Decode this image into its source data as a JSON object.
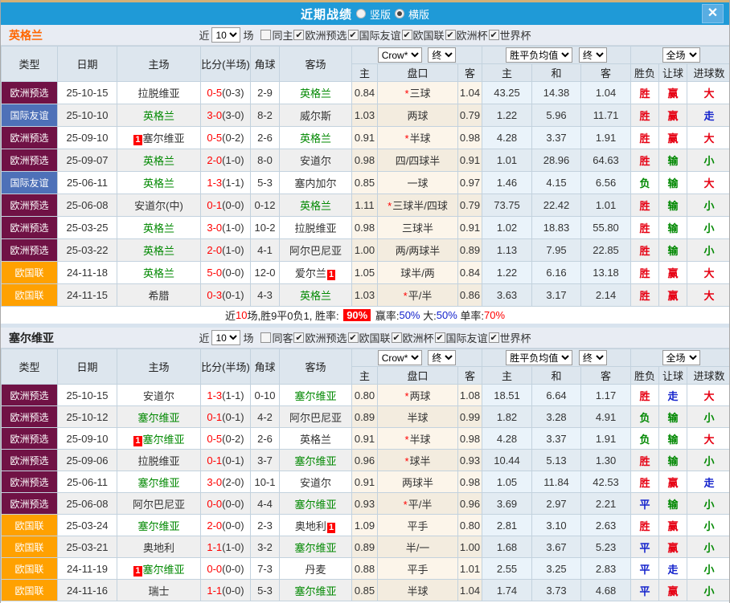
{
  "titlebar": {
    "title": "近期战绩",
    "vertical_label": "竖版",
    "horizontal_label": "横版",
    "selected_layout": "横版",
    "close_label": "✕"
  },
  "table_header": {
    "main": [
      "类型",
      "日期",
      "主场",
      "比分(半场)",
      "角球",
      "客场"
    ],
    "odds_group": {
      "select1": "Crow*",
      "select2": "终",
      "cols": [
        "主",
        "盘口",
        "客"
      ]
    },
    "avg_group": {
      "select1": "胜平负均值",
      "select2": "终",
      "cols": [
        "主",
        "和",
        "客"
      ]
    },
    "result_group": {
      "select": "全场",
      "cols": [
        "胜负",
        "让球",
        "进球数"
      ]
    }
  },
  "type_colors": {
    "欧洲预选": "#701245",
    "国际友谊": "#4e71b8",
    "欧国联": "#ffa101"
  },
  "result_colors": {
    "red": "#e60012",
    "green": "#008800",
    "blue": "#1322cc"
  },
  "score_color": "#ff0000",
  "team_focus_color": "#008800",
  "sections": [
    {
      "team": "英格兰",
      "team_color": "#ff6600",
      "filter": {
        "near": "近",
        "count": "10",
        "games": "场",
        "same": {
          "label": "同主",
          "checked": false
        },
        "leagues": [
          {
            "label": "欧洲预选",
            "checked": true
          },
          {
            "label": "国际友谊",
            "checked": true
          },
          {
            "label": "欧国联",
            "checked": true
          },
          {
            "label": "欧洲杯",
            "checked": true
          },
          {
            "label": "世界杯",
            "checked": true
          }
        ]
      },
      "rows": [
        {
          "type": "欧洲预选",
          "date": "25-10-15",
          "home": {
            "n": "拉脱维亚"
          },
          "score": "0-5",
          "half": "(0-3)",
          "corner": "2-9",
          "away": {
            "n": "英格兰",
            "f": 1
          },
          "o1": "0.84",
          "hc": {
            "s": 1,
            "t": "三球"
          },
          "o2": "1.04",
          "a1": "43.25",
          "a2": "14.38",
          "a3": "1.04",
          "res": {
            "t": "胜",
            "c": "red"
          },
          "hcr": {
            "t": "赢",
            "c": "red"
          },
          "goal": {
            "t": "大",
            "c": "red"
          }
        },
        {
          "type": "国际友谊",
          "date": "25-10-10",
          "home": {
            "n": "英格兰",
            "f": 1
          },
          "score": "3-0",
          "half": "(3-0)",
          "corner": "8-2",
          "away": {
            "n": "威尔斯"
          },
          "o1": "1.03",
          "hc": {
            "t": "两球"
          },
          "o2": "0.79",
          "a1": "1.22",
          "a2": "5.96",
          "a3": "11.71",
          "res": {
            "t": "胜",
            "c": "red"
          },
          "hcr": {
            "t": "赢",
            "c": "red"
          },
          "goal": {
            "t": "走",
            "c": "blue"
          }
        },
        {
          "type": "欧洲预选",
          "date": "25-09-10",
          "home": {
            "n": "塞尔维亚",
            "b": "before"
          },
          "score": "0-5",
          "half": "(0-2)",
          "corner": "2-6",
          "away": {
            "n": "英格兰",
            "f": 1
          },
          "o1": "0.91",
          "hc": {
            "s": 1,
            "t": "半球"
          },
          "o2": "0.98",
          "a1": "4.28",
          "a2": "3.37",
          "a3": "1.91",
          "res": {
            "t": "胜",
            "c": "red"
          },
          "hcr": {
            "t": "赢",
            "c": "red"
          },
          "goal": {
            "t": "大",
            "c": "red"
          }
        },
        {
          "type": "欧洲预选",
          "date": "25-09-07",
          "home": {
            "n": "英格兰",
            "f": 1
          },
          "score": "2-0",
          "half": "(1-0)",
          "corner": "8-0",
          "away": {
            "n": "安道尔"
          },
          "o1": "0.98",
          "hc": {
            "t": "四/四球半"
          },
          "o2": "0.91",
          "a1": "1.01",
          "a2": "28.96",
          "a3": "64.63",
          "res": {
            "t": "胜",
            "c": "red"
          },
          "hcr": {
            "t": "输",
            "c": "green"
          },
          "goal": {
            "t": "小",
            "c": "green"
          }
        },
        {
          "type": "国际友谊",
          "date": "25-06-11",
          "home": {
            "n": "英格兰",
            "f": 1
          },
          "score": "1-3",
          "half": "(1-1)",
          "corner": "5-3",
          "away": {
            "n": "塞内加尔"
          },
          "o1": "0.85",
          "hc": {
            "t": "一球"
          },
          "o2": "0.97",
          "a1": "1.46",
          "a2": "4.15",
          "a3": "6.56",
          "res": {
            "t": "负",
            "c": "green"
          },
          "hcr": {
            "t": "输",
            "c": "green"
          },
          "goal": {
            "t": "大",
            "c": "red"
          }
        },
        {
          "type": "欧洲预选",
          "date": "25-06-08",
          "home": {
            "n": "安道尔(中)"
          },
          "score": "0-1",
          "half": "(0-0)",
          "corner": "0-12",
          "away": {
            "n": "英格兰",
            "f": 1
          },
          "o1": "1.11",
          "hc": {
            "s": 1,
            "t": "三球半/四球"
          },
          "o2": "0.79",
          "a1": "73.75",
          "a2": "22.42",
          "a3": "1.01",
          "res": {
            "t": "胜",
            "c": "red"
          },
          "hcr": {
            "t": "输",
            "c": "green"
          },
          "goal": {
            "t": "小",
            "c": "green"
          }
        },
        {
          "type": "欧洲预选",
          "date": "25-03-25",
          "home": {
            "n": "英格兰",
            "f": 1
          },
          "score": "3-0",
          "half": "(1-0)",
          "corner": "10-2",
          "away": {
            "n": "拉脱维亚"
          },
          "o1": "0.98",
          "hc": {
            "t": "三球半"
          },
          "o2": "0.91",
          "a1": "1.02",
          "a2": "18.83",
          "a3": "55.80",
          "res": {
            "t": "胜",
            "c": "red"
          },
          "hcr": {
            "t": "输",
            "c": "green"
          },
          "goal": {
            "t": "小",
            "c": "green"
          }
        },
        {
          "type": "欧洲预选",
          "date": "25-03-22",
          "home": {
            "n": "英格兰",
            "f": 1
          },
          "score": "2-0",
          "half": "(1-0)",
          "corner": "4-1",
          "away": {
            "n": "阿尔巴尼亚"
          },
          "o1": "1.00",
          "hc": {
            "t": "两/两球半"
          },
          "o2": "0.89",
          "a1": "1.13",
          "a2": "7.95",
          "a3": "22.85",
          "res": {
            "t": "胜",
            "c": "red"
          },
          "hcr": {
            "t": "输",
            "c": "green"
          },
          "goal": {
            "t": "小",
            "c": "green"
          }
        },
        {
          "type": "欧国联",
          "date": "24-11-18",
          "home": {
            "n": "英格兰",
            "f": 1
          },
          "score": "5-0",
          "half": "(0-0)",
          "corner": "12-0",
          "away": {
            "n": "爱尔兰",
            "b": "after"
          },
          "o1": "1.05",
          "hc": {
            "t": "球半/两"
          },
          "o2": "0.84",
          "a1": "1.22",
          "a2": "6.16",
          "a3": "13.18",
          "res": {
            "t": "胜",
            "c": "red"
          },
          "hcr": {
            "t": "赢",
            "c": "red"
          },
          "goal": {
            "t": "大",
            "c": "red"
          }
        },
        {
          "type": "欧国联",
          "date": "24-11-15",
          "home": {
            "n": "希腊"
          },
          "score": "0-3",
          "half": "(0-1)",
          "corner": "4-3",
          "away": {
            "n": "英格兰",
            "f": 1
          },
          "o1": "1.03",
          "hc": {
            "s": 1,
            "t": "平/半"
          },
          "o2": "0.86",
          "a1": "3.63",
          "a2": "3.17",
          "a3": "2.14",
          "res": {
            "t": "胜",
            "c": "red"
          },
          "hcr": {
            "t": "赢",
            "c": "red"
          },
          "goal": {
            "t": "大",
            "c": "red"
          }
        }
      ],
      "summary": {
        "parts": [
          {
            "t": "近"
          },
          {
            "t": "10",
            "c": "red"
          },
          {
            "t": "场,胜9平0负1, 胜率: "
          },
          {
            "t": "90%",
            "c": "badge"
          },
          {
            "t": " 赢率:"
          },
          {
            "t": "50%",
            "c": "blue"
          },
          {
            "t": " 大:"
          },
          {
            "t": "50%",
            "c": "blue"
          },
          {
            "t": " 单率:"
          },
          {
            "t": "70%",
            "c": "red"
          }
        ]
      }
    },
    {
      "team": "塞尔维亚",
      "team_color": "#222222",
      "filter": {
        "near": "近",
        "count": "10",
        "games": "场",
        "same": {
          "label": "同客",
          "checked": false
        },
        "leagues": [
          {
            "label": "欧洲预选",
            "checked": true
          },
          {
            "label": "欧国联",
            "checked": true
          },
          {
            "label": "欧洲杯",
            "checked": true
          },
          {
            "label": "国际友谊",
            "checked": true
          },
          {
            "label": "世界杯",
            "checked": true
          }
        ]
      },
      "rows": [
        {
          "type": "欧洲预选",
          "date": "25-10-15",
          "home": {
            "n": "安道尔"
          },
          "score": "1-3",
          "half": "(1-1)",
          "corner": "0-10",
          "away": {
            "n": "塞尔维亚",
            "f": 1
          },
          "o1": "0.80",
          "hc": {
            "s": 1,
            "t": "两球"
          },
          "o2": "1.08",
          "a1": "18.51",
          "a2": "6.64",
          "a3": "1.17",
          "res": {
            "t": "胜",
            "c": "red"
          },
          "hcr": {
            "t": "走",
            "c": "blue"
          },
          "goal": {
            "t": "大",
            "c": "red"
          }
        },
        {
          "type": "欧洲预选",
          "date": "25-10-12",
          "home": {
            "n": "塞尔维亚",
            "f": 1
          },
          "score": "0-1",
          "half": "(0-1)",
          "corner": "4-2",
          "away": {
            "n": "阿尔巴尼亚"
          },
          "o1": "0.89",
          "hc": {
            "t": "半球"
          },
          "o2": "0.99",
          "a1": "1.82",
          "a2": "3.28",
          "a3": "4.91",
          "res": {
            "t": "负",
            "c": "green"
          },
          "hcr": {
            "t": "输",
            "c": "green"
          },
          "goal": {
            "t": "小",
            "c": "green"
          }
        },
        {
          "type": "欧洲预选",
          "date": "25-09-10",
          "home": {
            "n": "塞尔维亚",
            "f": 1,
            "b": "before"
          },
          "score": "0-5",
          "half": "(0-2)",
          "corner": "2-6",
          "away": {
            "n": "英格兰"
          },
          "o1": "0.91",
          "hc": {
            "s": 1,
            "t": "半球"
          },
          "o2": "0.98",
          "a1": "4.28",
          "a2": "3.37",
          "a3": "1.91",
          "res": {
            "t": "负",
            "c": "green"
          },
          "hcr": {
            "t": "输",
            "c": "green"
          },
          "goal": {
            "t": "大",
            "c": "red"
          }
        },
        {
          "type": "欧洲预选",
          "date": "25-09-06",
          "home": {
            "n": "拉脱维亚"
          },
          "score": "0-1",
          "half": "(0-1)",
          "corner": "3-7",
          "away": {
            "n": "塞尔维亚",
            "f": 1
          },
          "o1": "0.96",
          "hc": {
            "s": 1,
            "t": "球半"
          },
          "o2": "0.93",
          "a1": "10.44",
          "a2": "5.13",
          "a3": "1.30",
          "res": {
            "t": "胜",
            "c": "red"
          },
          "hcr": {
            "t": "输",
            "c": "green"
          },
          "goal": {
            "t": "小",
            "c": "green"
          }
        },
        {
          "type": "欧洲预选",
          "date": "25-06-11",
          "home": {
            "n": "塞尔维亚",
            "f": 1
          },
          "score": "3-0",
          "half": "(2-0)",
          "corner": "10-1",
          "away": {
            "n": "安道尔"
          },
          "o1": "0.91",
          "hc": {
            "t": "两球半"
          },
          "o2": "0.98",
          "a1": "1.05",
          "a2": "11.84",
          "a3": "42.53",
          "res": {
            "t": "胜",
            "c": "red"
          },
          "hcr": {
            "t": "赢",
            "c": "red"
          },
          "goal": {
            "t": "走",
            "c": "blue"
          }
        },
        {
          "type": "欧洲预选",
          "date": "25-06-08",
          "home": {
            "n": "阿尔巴尼亚"
          },
          "score": "0-0",
          "half": "(0-0)",
          "corner": "4-4",
          "away": {
            "n": "塞尔维亚",
            "f": 1
          },
          "o1": "0.93",
          "hc": {
            "s": 1,
            "t": "平/半"
          },
          "o2": "0.96",
          "a1": "3.69",
          "a2": "2.97",
          "a3": "2.21",
          "res": {
            "t": "平",
            "c": "blue"
          },
          "hcr": {
            "t": "输",
            "c": "green"
          },
          "goal": {
            "t": "小",
            "c": "green"
          }
        },
        {
          "type": "欧国联",
          "date": "25-03-24",
          "home": {
            "n": "塞尔维亚",
            "f": 1
          },
          "score": "2-0",
          "half": "(0-0)",
          "corner": "2-3",
          "away": {
            "n": "奥地利",
            "b": "after"
          },
          "o1": "1.09",
          "hc": {
            "t": "平手"
          },
          "o2": "0.80",
          "a1": "2.81",
          "a2": "3.10",
          "a3": "2.63",
          "res": {
            "t": "胜",
            "c": "red"
          },
          "hcr": {
            "t": "赢",
            "c": "red"
          },
          "goal": {
            "t": "小",
            "c": "green"
          }
        },
        {
          "type": "欧国联",
          "date": "25-03-21",
          "home": {
            "n": "奥地利"
          },
          "score": "1-1",
          "half": "(1-0)",
          "corner": "3-2",
          "away": {
            "n": "塞尔维亚",
            "f": 1
          },
          "o1": "0.89",
          "hc": {
            "t": "半/一"
          },
          "o2": "1.00",
          "a1": "1.68",
          "a2": "3.67",
          "a3": "5.23",
          "res": {
            "t": "平",
            "c": "blue"
          },
          "hcr": {
            "t": "赢",
            "c": "red"
          },
          "goal": {
            "t": "小",
            "c": "green"
          }
        },
        {
          "type": "欧国联",
          "date": "24-11-19",
          "home": {
            "n": "塞尔维亚",
            "f": 1,
            "b": "before"
          },
          "score": "0-0",
          "half": "(0-0)",
          "corner": "7-3",
          "away": {
            "n": "丹麦"
          },
          "o1": "0.88",
          "hc": {
            "t": "平手"
          },
          "o2": "1.01",
          "a1": "2.55",
          "a2": "3.25",
          "a3": "2.83",
          "res": {
            "t": "平",
            "c": "blue"
          },
          "hcr": {
            "t": "走",
            "c": "blue"
          },
          "goal": {
            "t": "小",
            "c": "green"
          }
        },
        {
          "type": "欧国联",
          "date": "24-11-16",
          "home": {
            "n": "瑞士"
          },
          "score": "1-1",
          "half": "(0-0)",
          "corner": "5-3",
          "away": {
            "n": "塞尔维亚",
            "f": 1
          },
          "o1": "0.85",
          "hc": {
            "t": "半球"
          },
          "o2": "1.04",
          "a1": "1.74",
          "a2": "3.73",
          "a3": "4.68",
          "res": {
            "t": "平",
            "c": "blue"
          },
          "hcr": {
            "t": "赢",
            "c": "red"
          },
          "goal": {
            "t": "小",
            "c": "green"
          }
        }
      ],
      "summary": null
    }
  ]
}
